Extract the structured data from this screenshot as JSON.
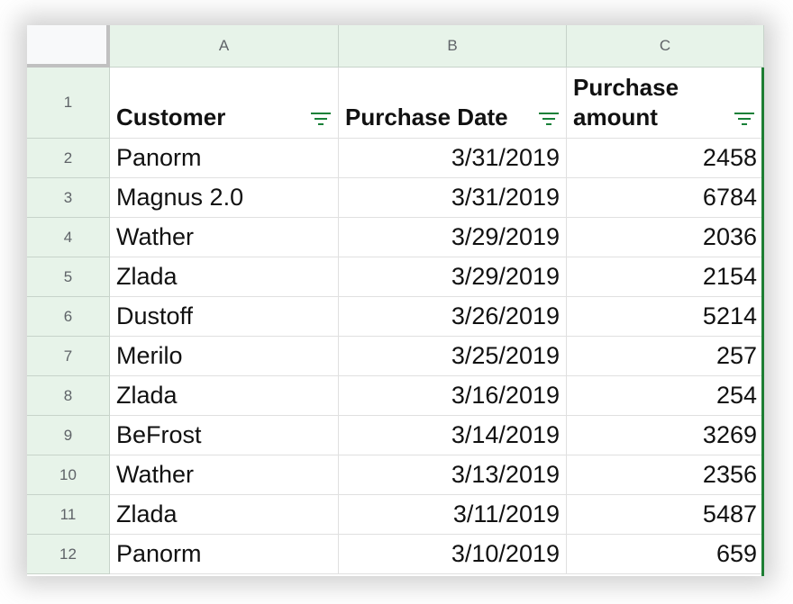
{
  "columns": [
    "A",
    "B",
    "C"
  ],
  "header_row": {
    "row_number": "1",
    "cells": [
      "Customer",
      "Purchase Date",
      "Purchase amount"
    ]
  },
  "filter_icon": "filter-icon",
  "rows": [
    {
      "num": "2",
      "customer": "Panorm",
      "date": "3/31/2019",
      "amount": "2458"
    },
    {
      "num": "3",
      "customer": "Magnus 2.0",
      "date": "3/31/2019",
      "amount": "6784"
    },
    {
      "num": "4",
      "customer": "Wather",
      "date": "3/29/2019",
      "amount": "2036"
    },
    {
      "num": "5",
      "customer": "Zlada",
      "date": "3/29/2019",
      "amount": "2154"
    },
    {
      "num": "6",
      "customer": "Dustoff",
      "date": "3/26/2019",
      "amount": "5214"
    },
    {
      "num": "7",
      "customer": "Merilo",
      "date": "3/25/2019",
      "amount": "257"
    },
    {
      "num": "8",
      "customer": "Zlada",
      "date": "3/16/2019",
      "amount": "254"
    },
    {
      "num": "9",
      "customer": "BeFrost",
      "date": "3/14/2019",
      "amount": "3269"
    },
    {
      "num": "10",
      "customer": "Wather",
      "date": "3/13/2019",
      "amount": "2356"
    },
    {
      "num": "11",
      "customer": "Zlada",
      "date": "3/11/2019",
      "amount": "5487"
    },
    {
      "num": "12",
      "customer": "Panorm",
      "date": "3/10/2019",
      "amount": "659"
    }
  ],
  "colors": {
    "header_bg": "#e7f3e9",
    "filter_green": "#188038",
    "grid_line": "#e0e0e0"
  }
}
